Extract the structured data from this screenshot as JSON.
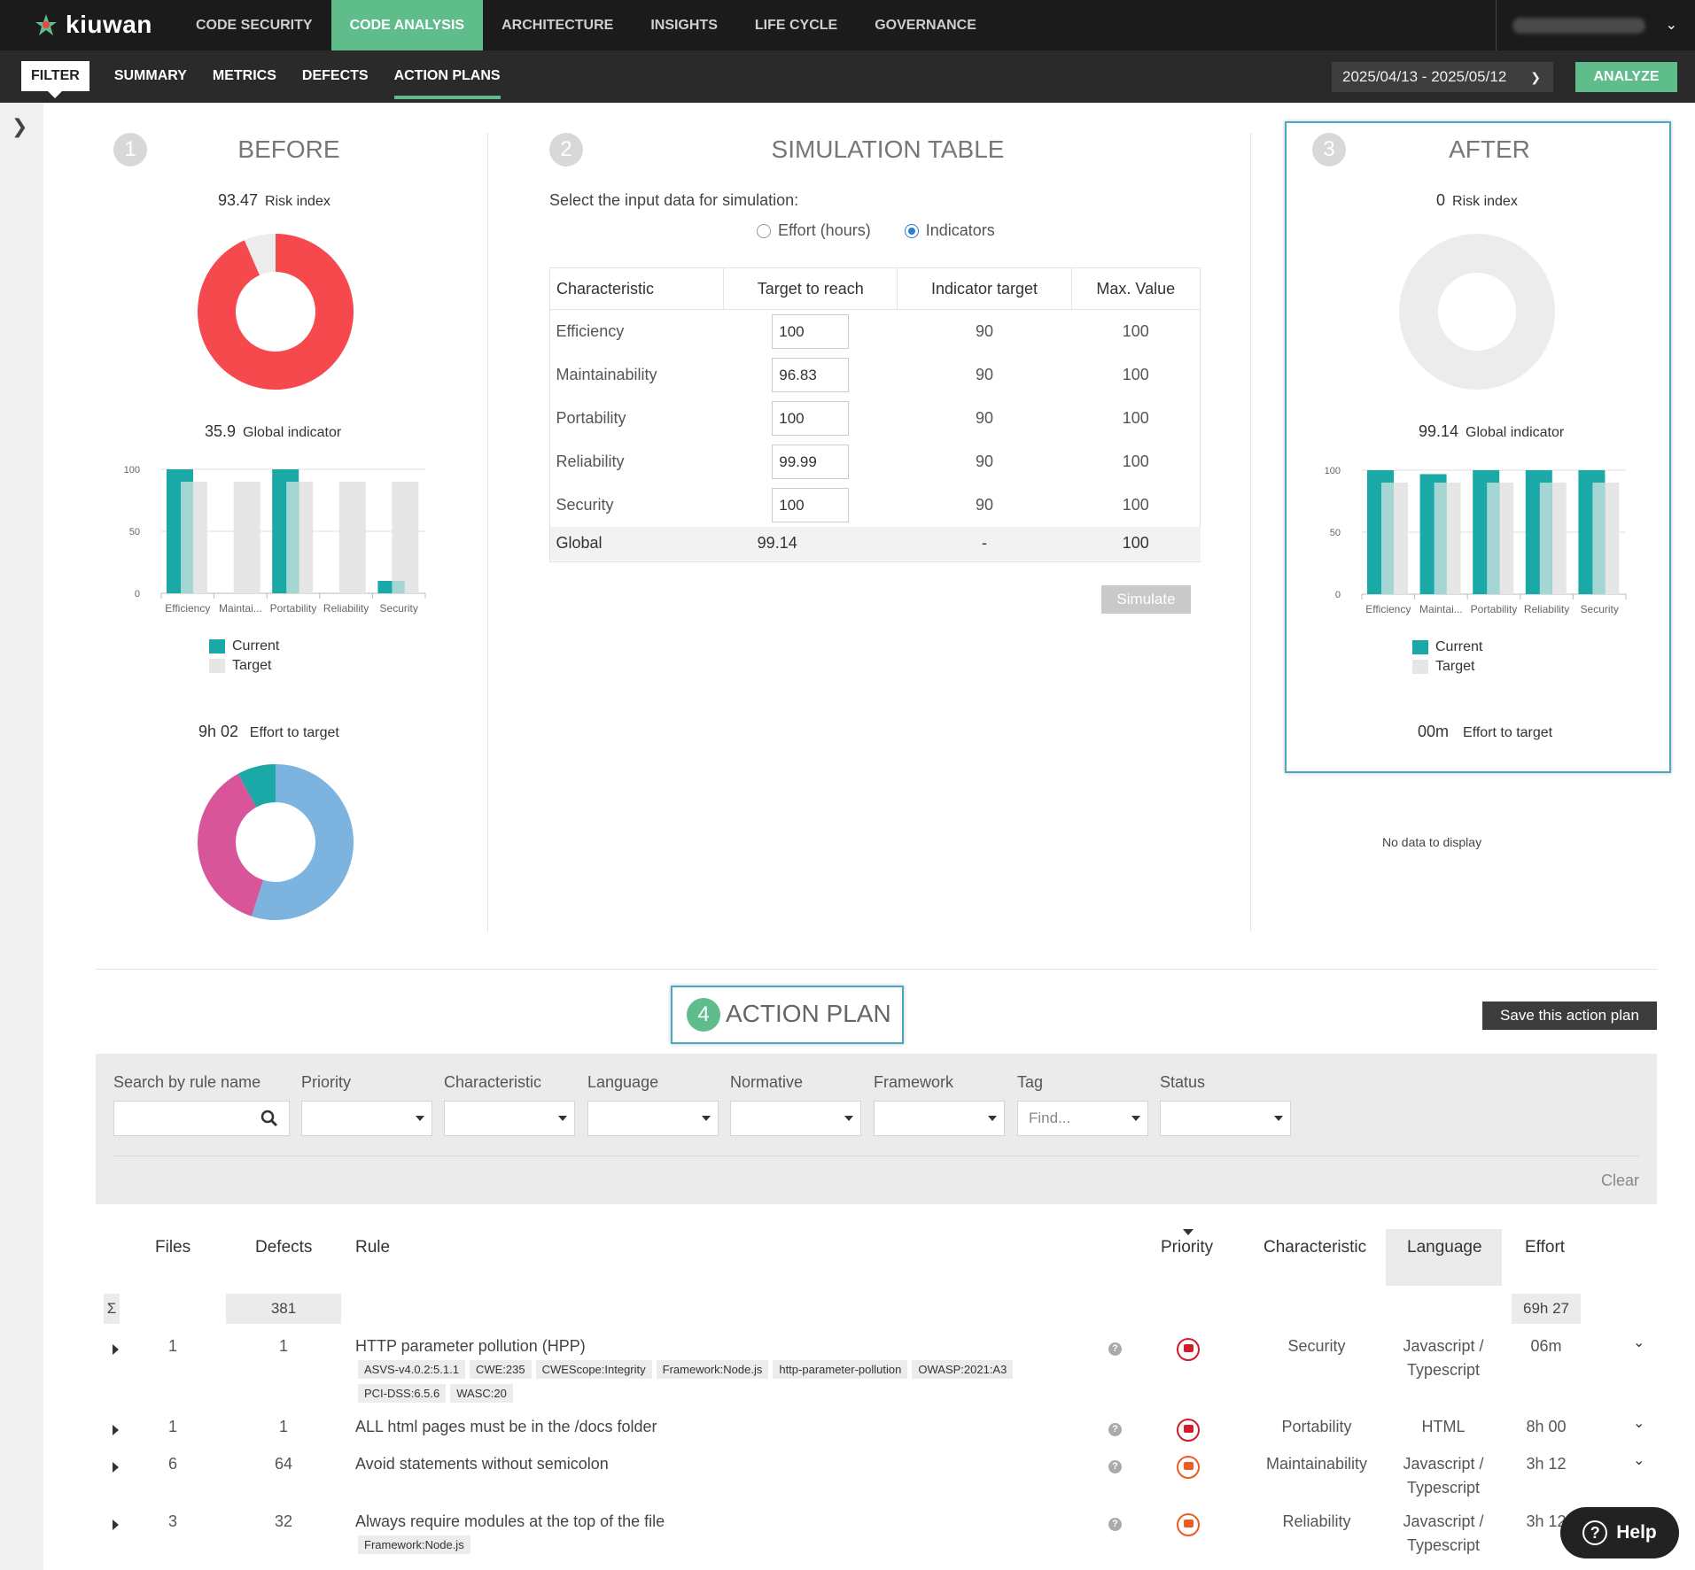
{
  "app": {
    "logo_text": "kiuwan"
  },
  "nav": {
    "items": [
      "CODE SECURITY",
      "CODE ANALYSIS",
      "ARCHITECTURE",
      "INSIGHTS",
      "LIFE CYCLE",
      "GOVERNANCE"
    ],
    "active": "CODE ANALYSIS"
  },
  "subnav": {
    "items": [
      "FILTER",
      "SUMMARY",
      "METRICS",
      "DEFECTS",
      "ACTION PLANS"
    ],
    "active": "ACTION PLANS"
  },
  "date_range": "2025/04/13 - 2025/05/12",
  "analyze_label": "ANALYZE",
  "before": {
    "number": "1",
    "title": "BEFORE",
    "risk_value": "93.47",
    "risk_label": "Risk index",
    "risk_fraction": 0.9347,
    "global_value": "35.9",
    "global_label": "Global indicator",
    "effort_value": "9h 02",
    "effort_label": "Effort to target",
    "effort_slices": [
      {
        "value": 0.55,
        "color": "#7cb3df"
      },
      {
        "value": 0.37,
        "color": "#d9559a"
      },
      {
        "value": 0.08,
        "color": "#1aa9a6"
      }
    ]
  },
  "after": {
    "number": "3",
    "title": "AFTER",
    "risk_value": "0",
    "risk_label": "Risk index",
    "risk_fraction": 0,
    "global_value": "99.14",
    "global_label": "Global indicator",
    "effort_value": "00m",
    "effort_label": "Effort to target",
    "no_data": "No data to display"
  },
  "chart_data": [
    {
      "type": "bar",
      "name": "before",
      "categories": [
        "Efficiency",
        "Maintai...",
        "Portability",
        "Reliability",
        "Security"
      ],
      "series": [
        {
          "name": "Current",
          "values": [
            100,
            0,
            100,
            0,
            10
          ],
          "color": "#1aa9a6"
        },
        {
          "name": "Target",
          "values": [
            90,
            90,
            90,
            90,
            90
          ],
          "color": "#e6e6e6"
        }
      ],
      "yticks": [
        "0",
        "50",
        "100"
      ],
      "ylim": [
        0,
        100
      ]
    },
    {
      "type": "bar",
      "name": "after",
      "categories": [
        "Efficiency",
        "Maintai...",
        "Portability",
        "Reliability",
        "Security"
      ],
      "series": [
        {
          "name": "Current",
          "values": [
            100,
            96.83,
            100,
            99.99,
            100
          ],
          "color": "#1aa9a6"
        },
        {
          "name": "Target",
          "values": [
            90,
            90,
            90,
            90,
            90
          ],
          "color": "#e6e6e6"
        }
      ],
      "yticks": [
        "0",
        "50",
        "100"
      ],
      "ylim": [
        0,
        100
      ]
    }
  ],
  "legend": {
    "current": "Current",
    "target": "Target"
  },
  "simulation": {
    "number": "2",
    "title": "SIMULATION TABLE",
    "select_label": "Select the input data for simulation:",
    "radio_effort": "Effort (hours)",
    "radio_indicators": "Indicators",
    "selected": "Indicators",
    "headers": [
      "Characteristic",
      "Target to reach",
      "Indicator target",
      "Max. Value"
    ],
    "rows": [
      {
        "name": "Efficiency",
        "target": "100",
        "indicator": "90",
        "max": "100"
      },
      {
        "name": "Maintainability",
        "target": "96.83",
        "indicator": "90",
        "max": "100"
      },
      {
        "name": "Portability",
        "target": "100",
        "indicator": "90",
        "max": "100"
      },
      {
        "name": "Reliability",
        "target": "99.99",
        "indicator": "90",
        "max": "100"
      },
      {
        "name": "Security",
        "target": "100",
        "indicator": "90",
        "max": "100"
      }
    ],
    "global": {
      "name": "Global",
      "target": "99.14",
      "indicator": "-",
      "max": "100"
    },
    "simulate_label": "Simulate"
  },
  "action_plan": {
    "number": "4",
    "title": "ACTION PLAN",
    "save_label": "Save this action plan",
    "filters": {
      "search": "Search by rule name",
      "priority": "Priority",
      "characteristic": "Characteristic",
      "language": "Language",
      "normative": "Normative",
      "framework": "Framework",
      "tag": "Tag",
      "tag_placeholder": "Find...",
      "status": "Status",
      "clear": "Clear"
    },
    "columns": {
      "files": "Files",
      "defects": "Defects",
      "rule": "Rule",
      "priority": "Priority",
      "characteristic": "Characteristic",
      "language": "Language",
      "effort": "Effort"
    },
    "sum_symbol": "Σ",
    "total_defects": "381",
    "total_effort": "69h 27",
    "rows": [
      {
        "files": "1",
        "defects": "1",
        "rule": "HTTP parameter pollution (HPP)",
        "tags": [
          "ASVS-v4.0.2:5.1.1",
          "CWE:235",
          "CWEScope:Integrity",
          "Framework:Node.js",
          "http-parameter-pollution",
          "OWASP:2021:A3",
          "PCI-DSS:6.5.6",
          "WASC:20"
        ],
        "priority": "red",
        "characteristic": "Security",
        "language": [
          "Javascript /",
          "Typescript"
        ],
        "effort": "06m"
      },
      {
        "files": "1",
        "defects": "1",
        "rule": "ALL html pages must be in the /docs folder",
        "tags": [],
        "priority": "red",
        "characteristic": "Portability",
        "language": [
          "HTML"
        ],
        "effort": "8h 00"
      },
      {
        "files": "6",
        "defects": "64",
        "rule": "Avoid statements without semicolon",
        "tags": [],
        "priority": "orange",
        "characteristic": "Maintainability",
        "language": [
          "Javascript /",
          "Typescript"
        ],
        "effort": "3h 12"
      },
      {
        "files": "3",
        "defects": "32",
        "rule": "Always require modules at the top of the file",
        "tags": [
          "Framework:Node.js"
        ],
        "priority": "orange",
        "characteristic": "Reliability",
        "language": [
          "Javascript /",
          "Typescript"
        ],
        "effort": "3h 12"
      }
    ]
  },
  "help_label": "Help"
}
